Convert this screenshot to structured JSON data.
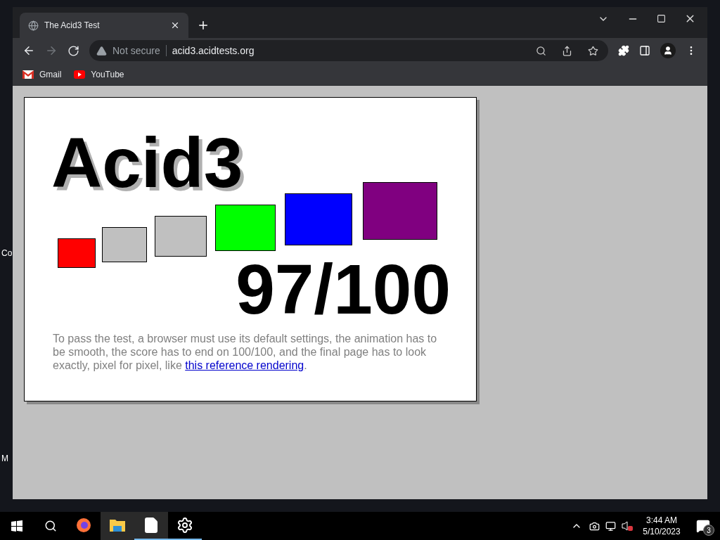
{
  "desktop_labels": [
    "Co",
    "M"
  ],
  "browser": {
    "tabs": [
      {
        "title": "The Acid3 Test",
        "selected": true
      }
    ],
    "address": {
      "security": "Not secure",
      "url": "acid3.acidtests.org"
    },
    "bookmarks": [
      {
        "label": "Gmail",
        "kind": "mail"
      },
      {
        "label": "YouTube",
        "kind": "video"
      }
    ]
  },
  "page": {
    "heading": "Acid3",
    "boxes": [
      {
        "color": "#ff0000"
      },
      {
        "color": "#c0c0c0"
      },
      {
        "color": "#c0c0c0"
      },
      {
        "color": "#00ff00"
      },
      {
        "color": "#0000ff"
      },
      {
        "color": "#800080"
      }
    ],
    "score": "97/100",
    "note": "To pass the test, a browser must use its default settings, the animation has to be smooth, the score has to end on 100/100, and the final page has to look exactly, pixel for pixel, like",
    "link": "this reference rendering",
    "note_end": "."
  },
  "taskbar": {
    "apps": [
      {
        "kind": "firefox",
        "open": false,
        "selected": false
      },
      {
        "kind": "folder",
        "open": false,
        "selected": true
      },
      {
        "kind": "document",
        "open": true,
        "selected": true
      },
      {
        "kind": "settings",
        "open": true,
        "selected": false
      }
    ],
    "time": "3:44 AM",
    "date": "5/10/2023",
    "notifications": "3"
  }
}
